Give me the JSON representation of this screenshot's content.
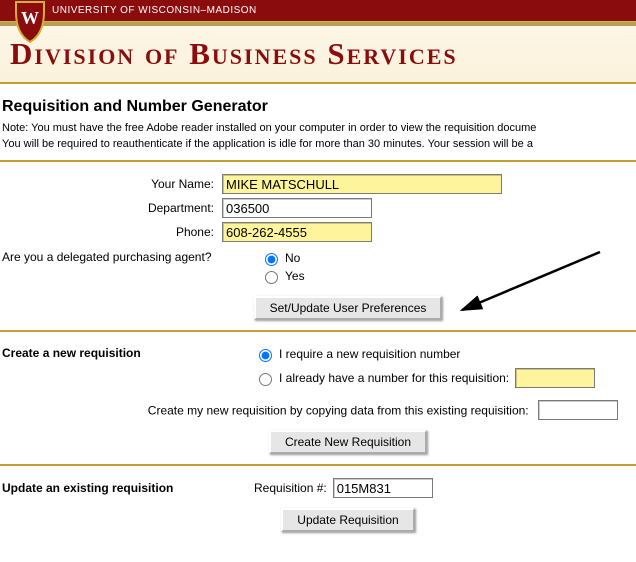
{
  "topbar": {
    "text": "UNIVERSITY OF WISCONSIN–MADISON"
  },
  "division_title": "Division of Business Services",
  "page_title": "Requisition and Number Generator",
  "note1": "Note: You must have the free Adobe reader installed on your computer in order to view the requisition docume",
  "note2": "You will be required to reauthenticate if the application is idle for more than 30 minutes. Your session will be a",
  "labels": {
    "name": "Your Name:",
    "dept": "Department:",
    "phone": "Phone:",
    "delegated": "Are you a delegated purchasing agent?",
    "no": "No",
    "yes": "Yes",
    "create_section": "Create a new requisition",
    "need_new": "I require a new requisition number",
    "have_number": "I already have a number for this requisition:",
    "copy_from": "Create my new requisition by copying data from this existing requisition:",
    "update_section": "Update an existing requisition",
    "req_num": "Requisition #:"
  },
  "buttons": {
    "set_prefs": "Set/Update User Preferences",
    "create_req": "Create New Requisition",
    "update_req": "Update Requisition"
  },
  "values": {
    "name": "MIKE MATSCHULL",
    "dept": "036500",
    "phone": "608-262-4555",
    "have_number_val": "",
    "copy_from_val": "",
    "req_num": "015M831"
  }
}
